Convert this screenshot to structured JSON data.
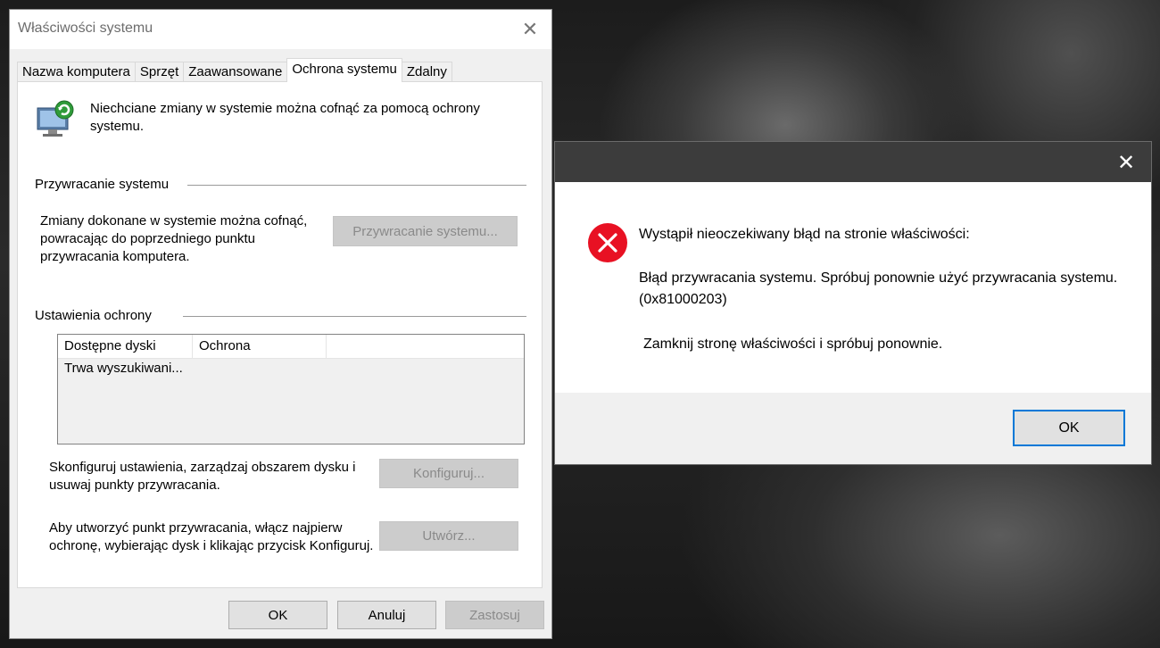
{
  "sysprop": {
    "title": "Właściwości systemu",
    "close_glyph": "✕",
    "tabs": [
      "Nazwa komputera",
      "Sprzęt",
      "Zaawansowane",
      "Ochrona systemu",
      "Zdalny"
    ],
    "active_tab": "Ochrona systemu",
    "intro_text": "Niechciane zmiany w systemie można cofnąć za pomocą ochrony systemu.",
    "restore_group": {
      "label": "Przywracanie systemu",
      "text": "Zmiany dokonane w systemie można cofnąć, powracając do poprzedniego punktu przywracania komputera.",
      "button": "Przywracanie systemu..."
    },
    "protection_group": {
      "label": "Ustawienia ochrony",
      "columns": [
        "Dostępne dyski",
        "Ochrona"
      ],
      "rows": [
        "Trwa wyszukiwani..."
      ],
      "configure_text": "Skonfiguruj ustawienia, zarządzaj obszarem dysku i usuwaj punkty przywracania.",
      "configure_button": "Konfiguruj...",
      "create_text": "Aby utworzyć punkt przywracania, włącz najpierw ochronę, wybierając dysk i klikając przycisk Konfiguruj.",
      "create_button": "Utwórz..."
    },
    "footer": {
      "ok": "OK",
      "cancel": "Anuluj",
      "apply": "Zastosuj"
    }
  },
  "error_dialog": {
    "close_glyph": "✕",
    "icon": "error-icon",
    "heading": "Wystąpił nieoczekiwany błąd na stronie właściwości:",
    "message": "Błąd przywracania systemu. Spróbuj ponownie użyć przywracania systemu. (0x81000203)",
    "hint": "Zamknij stronę właściwości i spróbuj ponownie.",
    "ok": "OK"
  },
  "colors": {
    "focus_border": "#0078d7",
    "error_red": "#e81123",
    "dialog_titlebar": "#3c3c3c"
  }
}
